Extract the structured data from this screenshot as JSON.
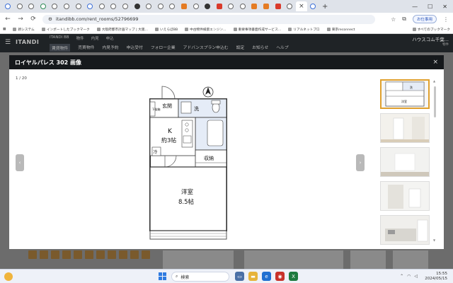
{
  "browser": {
    "tabs_count": 27,
    "active_tab_index": 25,
    "active_tab_glyph": "×",
    "newtab_glyph": "+",
    "win_controls": [
      "—",
      "☐",
      "✕"
    ],
    "address": {
      "url": "itandibb.com/rent_rooms/52796699",
      "profile_label": "お仕事用"
    },
    "bookmarks": [
      "新システム",
      "インポートしたブックマーク",
      "大阪府都市計画マップ | 大阪...",
      "いえらぼBB",
      "中古物件検索エンジン...",
      "重要事項書面作成サービス...",
      "リアルネットプロ",
      "東京reconnect"
    ],
    "bookmarks_right": "すべてのブックマーク"
  },
  "site": {
    "hamburger": "☰",
    "logo": "ITANDI",
    "top_menu": [
      "ITANDI BB",
      "物件",
      "内見",
      "申込"
    ],
    "nav": [
      "賃貸物件",
      "売買物件",
      "内見予約",
      "申込受付",
      "フォロー企業",
      "アドバンスプラン申込む",
      "設定",
      "お知らせ",
      "ヘルプ"
    ],
    "user_name": "ハウスコム千葉...",
    "user_sub": "物件"
  },
  "modal": {
    "title": "ロイヤルパレス 302 画像",
    "close_glyph": "×",
    "counter": "1 / 20",
    "prev_glyph": "‹",
    "next_glyph": "›",
    "floorplan_labels": {
      "entrance": "玄関",
      "shoe": "下駄箱",
      "wash": "洗",
      "kitchen": "K",
      "kitchen_size": "約3帖",
      "fridge": "冷",
      "storage": "収納",
      "room": "洋室",
      "room_size": "8.5帖"
    },
    "thumb_floorplan_labels": [
      "洗",
      "洋室"
    ]
  },
  "taskbar": {
    "search_placeholder": "検索",
    "time": "15:55",
    "date": "2024/05/15"
  }
}
